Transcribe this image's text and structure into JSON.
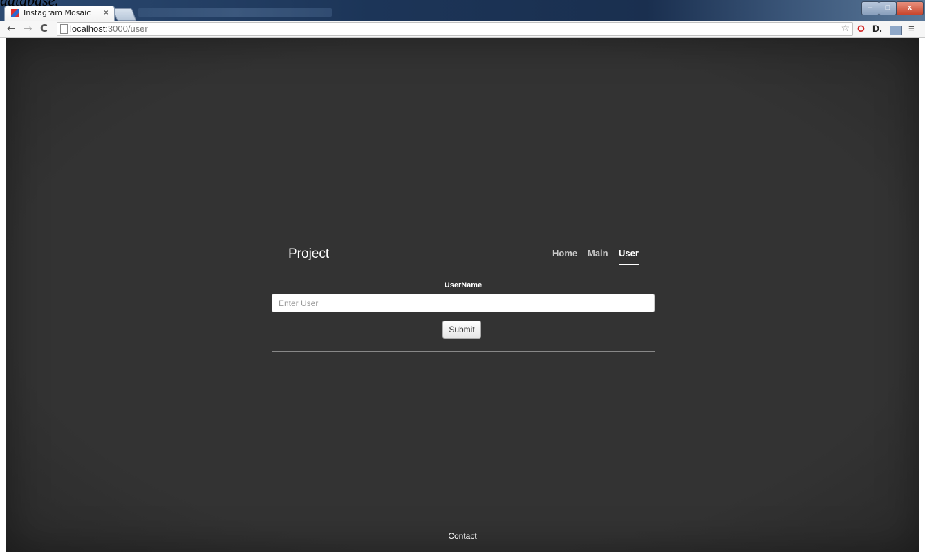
{
  "overlay_text": "database.",
  "browser": {
    "tab_title": "Instagram Mosaic",
    "tab_close": "×",
    "url_host": "localhost",
    "url_path": ":3000/user",
    "window_min": "–",
    "window_max": "□",
    "window_close": "x",
    "back": "←",
    "forward": "→",
    "reload": "C",
    "star": "☆",
    "ext_d": "D.",
    "ext_opera": "O",
    "menu": "≡"
  },
  "page": {
    "brand": "Project",
    "nav": [
      {
        "label": "Home",
        "active": false
      },
      {
        "label": "Main",
        "active": false
      },
      {
        "label": "User",
        "active": true
      }
    ],
    "form": {
      "label": "UserName",
      "input_value": "",
      "input_placeholder": "Enter User",
      "submit_label": "Submit"
    },
    "footer": "Contact"
  },
  "colors": {
    "page_background": "#333333",
    "text": "#ffffff",
    "nav_inactive": "#c8c8c8"
  }
}
